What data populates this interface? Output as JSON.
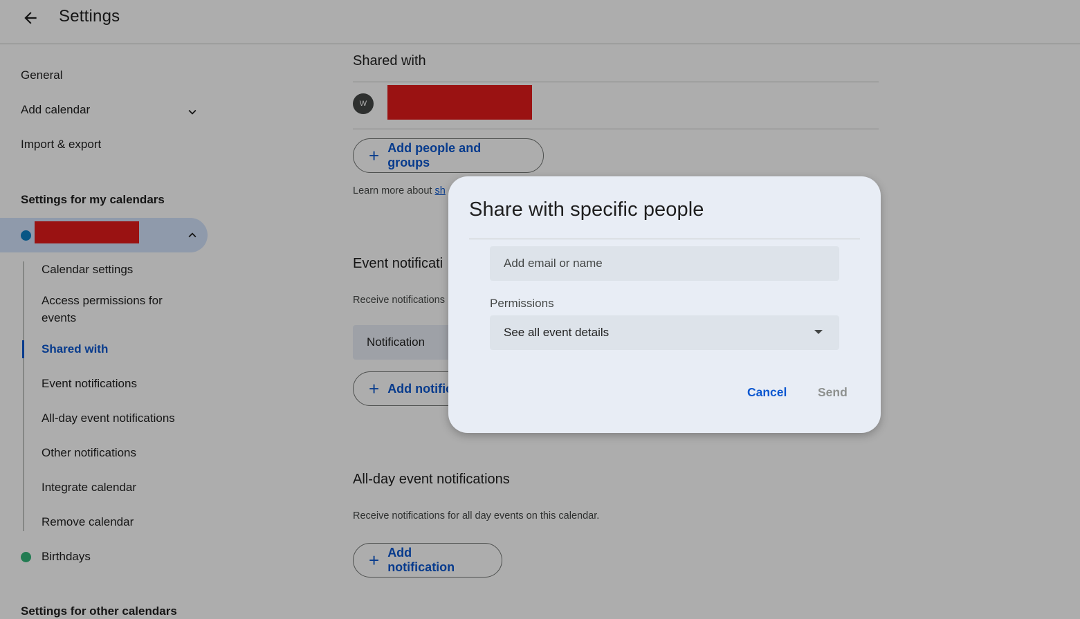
{
  "header": {
    "title": "Settings"
  },
  "sidebar": {
    "general": "General",
    "add_calendar": "Add calendar",
    "import_export": "Import & export",
    "my_calendars_heading": "Settings for my calendars",
    "selected_calendar_color": "#0b7fc4",
    "sub_items": [
      "Calendar settings",
      "Access permissions for events",
      "Shared with",
      "Event notifications",
      "All-day event notifications",
      "Other notifications",
      "Integrate calendar",
      "Remove calendar"
    ],
    "birthdays": "Birthdays",
    "birthdays_color": "#33b679",
    "other_calendars_heading": "Settings for other calendars"
  },
  "main": {
    "shared_with_title": "Shared with",
    "avatar_initial": "W",
    "add_people_label": "Add people and groups",
    "learn_more_text": "Learn more about ",
    "learn_more_link": "sh",
    "event_notifications_title": "Event notificati",
    "event_notifications_desc": "Receive notifications",
    "notification_select": "Notification",
    "add_notification_partial": "Add notific",
    "allday_title": "All-day event notifications",
    "allday_desc": "Receive notifications for all day events on this calendar.",
    "add_notification_label": "Add notification"
  },
  "dialog": {
    "title": "Share with specific people",
    "email_placeholder": "Add email or name",
    "permissions_label": "Permissions",
    "permissions_value": "See all event details",
    "cancel_label": "Cancel",
    "send_label": "Send"
  },
  "colors": {
    "accent": "#0b57d0",
    "send_disabled": "#8e918f"
  }
}
